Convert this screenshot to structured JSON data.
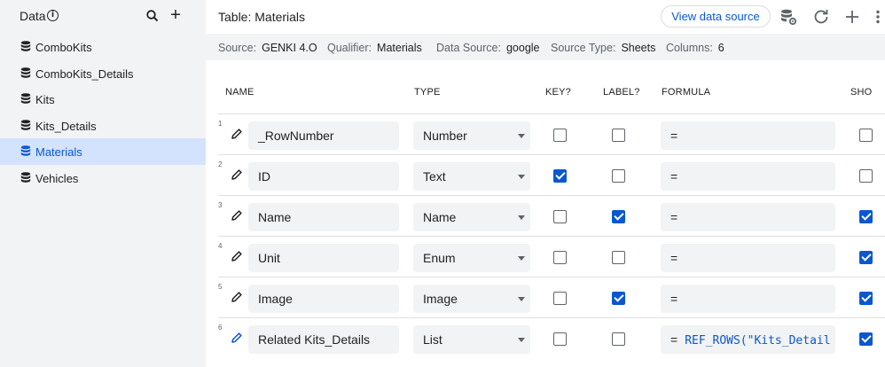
{
  "sidebar": {
    "title": "Data",
    "items": [
      {
        "label": "ComboKits",
        "active": false
      },
      {
        "label": "ComboKits_Details",
        "active": false
      },
      {
        "label": "Kits",
        "active": false
      },
      {
        "label": "Kits_Details",
        "active": false
      },
      {
        "label": "Materials",
        "active": true
      },
      {
        "label": "Vehicles",
        "active": false
      }
    ]
  },
  "header": {
    "title": "Table: Materials",
    "view_button": "View data source"
  },
  "info": {
    "source_label": "Source:",
    "source_value": "GENKI 4.O",
    "qualifier_label": "Qualifier:",
    "qualifier_value": "Materials",
    "datasource_label": "Data Source:",
    "datasource_value": "google",
    "sourcetype_label": "Source Type:",
    "sourcetype_value": "Sheets",
    "columns_label": "Columns:",
    "columns_value": "6"
  },
  "table": {
    "headers": {
      "name": "NAME",
      "type": "TYPE",
      "key": "KEY?",
      "label": "LABEL?",
      "formula": "FORMULA",
      "show": "SHO"
    },
    "rows": [
      {
        "num": "1",
        "name": "_RowNumber",
        "type": "Number",
        "key": false,
        "label": false,
        "formula_eq": "=",
        "formula": "",
        "show": false
      },
      {
        "num": "2",
        "name": "ID",
        "type": "Text",
        "key": true,
        "label": false,
        "formula_eq": "=",
        "formula": "",
        "show": false
      },
      {
        "num": "3",
        "name": "Name",
        "type": "Name",
        "key": false,
        "label": true,
        "formula_eq": "=",
        "formula": "",
        "show": true
      },
      {
        "num": "4",
        "name": "Unit",
        "type": "Enum",
        "key": false,
        "label": false,
        "formula_eq": "=",
        "formula": "",
        "show": true
      },
      {
        "num": "5",
        "name": "Image",
        "type": "Image",
        "key": false,
        "label": true,
        "formula_eq": "=",
        "formula": "",
        "show": true
      },
      {
        "num": "6",
        "name": "Related Kits_Details",
        "type": "List",
        "key": false,
        "label": false,
        "formula_eq": "=",
        "formula": "REF_ROWS(\"Kits_Detail",
        "show": true
      }
    ]
  },
  "colors": {
    "accent": "#0b57d0",
    "sidebar_bg": "#f1f3f4",
    "active_bg": "#d3e3fd"
  },
  "icons": {
    "search": "search-icon",
    "add": "plus-icon",
    "info": "info-icon",
    "db": "database-icon",
    "db_settings": "database-settings-icon",
    "refresh": "refresh-icon",
    "more": "more-vert-icon",
    "edit": "pencil-icon"
  }
}
